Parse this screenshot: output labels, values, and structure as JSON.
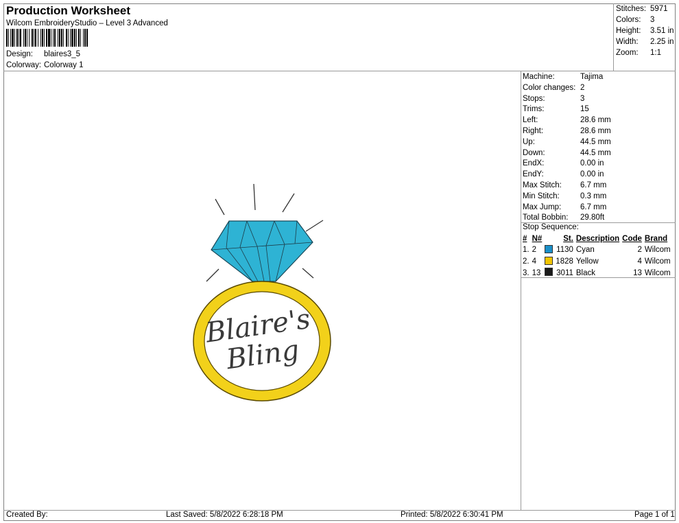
{
  "header": {
    "title": "Production Worksheet",
    "software": "Wilcom EmbroideryStudio – Level 3 Advanced",
    "design_label": "Design:",
    "design_value": "blaires3_5",
    "colorway_label": "Colorway:",
    "colorway_value": "Colorway 1"
  },
  "summary": [
    {
      "label": "Stitches:",
      "value": "5971"
    },
    {
      "label": "Colors:",
      "value": "3"
    },
    {
      "label": "Height:",
      "value": "3.51 in"
    },
    {
      "label": "Width:",
      "value": "2.25 in"
    },
    {
      "label": "Zoom:",
      "value": "1:1"
    }
  ],
  "machine_info": [
    {
      "label": "Machine:",
      "value": "Tajima"
    },
    {
      "label": "Color changes:",
      "value": "2"
    },
    {
      "label": "Stops:",
      "value": "3"
    },
    {
      "label": "Trims:",
      "value": "15"
    },
    {
      "label": "Left:",
      "value": "28.6 mm"
    },
    {
      "label": "Right:",
      "value": "28.6 mm"
    },
    {
      "label": "Up:",
      "value": "44.5 mm"
    },
    {
      "label": "Down:",
      "value": "44.5 mm"
    },
    {
      "label": "EndX:",
      "value": "0.00 in"
    },
    {
      "label": "EndY:",
      "value": "0.00 in"
    },
    {
      "label": "Max Stitch:",
      "value": "6.7 mm"
    },
    {
      "label": "Min Stitch:",
      "value": "0.3 mm"
    },
    {
      "label": "Max Jump:",
      "value": "6.7 mm"
    },
    {
      "label": "Total Bobbin:",
      "value": "29.80ft"
    }
  ],
  "stop_sequence": {
    "title": "Stop Sequence:",
    "headers": {
      "num": "#",
      "n": "N#",
      "st": "St.",
      "description": "Description",
      "code": "Code",
      "brand": "Brand"
    },
    "rows": [
      {
        "num": "1.",
        "n": "2",
        "color": "#1b8fc8",
        "st": "1130",
        "description": "Cyan",
        "code": "2",
        "brand": "Wilcom"
      },
      {
        "num": "2.",
        "n": "4",
        "color": "#f2c500",
        "st": "1828",
        "description": "Yellow",
        "code": "4",
        "brand": "Wilcom"
      },
      {
        "num": "3.",
        "n": "13",
        "color": "#1a1a1a",
        "st": "3011",
        "description": "Black",
        "code": "13",
        "brand": "Wilcom"
      }
    ]
  },
  "design_text": {
    "line1": "Blaire's",
    "line2": "Bling"
  },
  "colors": {
    "diamond": "#2eb3d4",
    "ring": "#f2d11a",
    "thread_black": "#3a3a3a"
  },
  "footer": {
    "created_by": "Created By:",
    "last_saved": "Last Saved: 5/8/2022 6:28:18 PM",
    "printed": "Printed: 5/8/2022 6:30:41 PM",
    "page": "Page 1 of 1"
  }
}
